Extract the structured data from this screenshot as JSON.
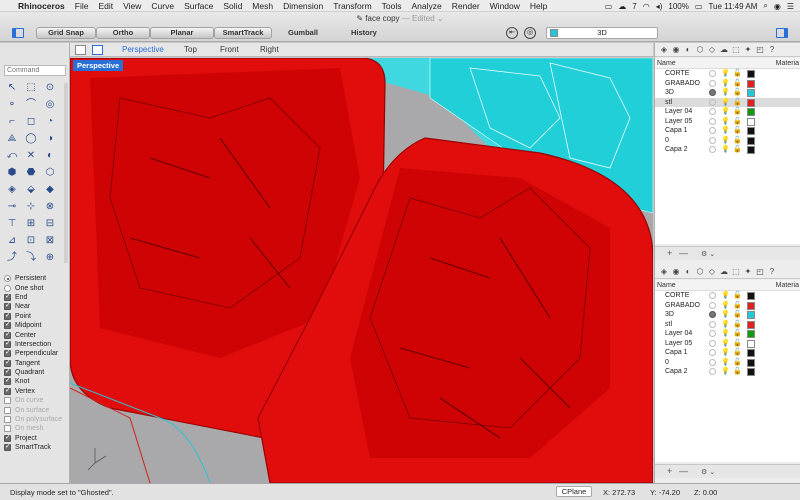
{
  "menubar": {
    "apple": "",
    "items": [
      "Rhinoceros",
      "File",
      "Edit",
      "View",
      "Curve",
      "Surface",
      "Solid",
      "Mesh",
      "Dimension",
      "Transform",
      "Tools",
      "Analyze",
      "Render",
      "Window",
      "Help"
    ],
    "status": {
      "wifi_count": "7",
      "battery": "100%",
      "clock": "Tue 11:49 AM"
    }
  },
  "window": {
    "title": "face copy",
    "edited": "— Edited ⌄"
  },
  "toolbar": {
    "grid_snap": "Grid Snap",
    "ortho": "Ortho",
    "planar": "Planar",
    "smarttrack": "SmartTrack",
    "gumball": "Gumball",
    "history": "History",
    "display_mode": "3D",
    "display_mode_color": "#22c8d8"
  },
  "viewtabs": {
    "perspective": "Perspective",
    "top": "Top",
    "front": "Front",
    "right": "Right"
  },
  "viewport": {
    "label": "Perspective",
    "background": "#a9a9ab",
    "mesh_color": "#e00000",
    "cyan_color": "#00d8e0"
  },
  "command": {
    "placeholder": "Command"
  },
  "tools": [
    "↖",
    "⬚",
    "⊙",
    "⚬",
    "⌒",
    "◎",
    "⌐",
    "◻",
    "◔",
    "⟁",
    "◯",
    "◑",
    "⤺",
    "✕",
    "◐",
    "⬢",
    "⬣",
    "⬡",
    "◈",
    "⬙",
    "◆",
    "⊸",
    "⊹",
    "⊗",
    "⊤",
    "⊞",
    "⊟",
    "⊿",
    "⊡",
    "⊠",
    "⤴",
    "⤵",
    "⊕"
  ],
  "osnaps": [
    {
      "label": "Persistent",
      "type": "radio",
      "checked": true
    },
    {
      "label": "One shot",
      "type": "radio",
      "checked": false
    },
    {
      "label": "End",
      "type": "check",
      "checked": true
    },
    {
      "label": "Near",
      "type": "check",
      "checked": true
    },
    {
      "label": "Point",
      "type": "check",
      "checked": true
    },
    {
      "label": "Midpoint",
      "type": "check",
      "checked": true
    },
    {
      "label": "Center",
      "type": "check",
      "checked": true
    },
    {
      "label": "Intersection",
      "type": "check",
      "checked": true
    },
    {
      "label": "Perpendicular",
      "type": "check",
      "checked": true
    },
    {
      "label": "Tangent",
      "type": "check",
      "checked": true
    },
    {
      "label": "Quadrant",
      "type": "check",
      "checked": true
    },
    {
      "label": "Knot",
      "type": "check",
      "checked": true
    },
    {
      "label": "Vertex",
      "type": "check",
      "checked": true
    },
    {
      "label": "On curve",
      "type": "check",
      "checked": false,
      "disabled": true
    },
    {
      "label": "On surface",
      "type": "check",
      "checked": false,
      "disabled": true
    },
    {
      "label": "On polysurface",
      "type": "check",
      "checked": false,
      "disabled": true
    },
    {
      "label": "On mesh",
      "type": "check",
      "checked": false,
      "disabled": true
    },
    {
      "label": "Project",
      "type": "check",
      "checked": true
    },
    {
      "label": "SmartTrack",
      "type": "check",
      "checked": true
    }
  ],
  "layers_panel": {
    "name_header": "Name",
    "material_header": "Materia",
    "layers_top": [
      {
        "name": "CORTE",
        "color": "#111111",
        "current": false
      },
      {
        "name": "GRABADO",
        "color": "#e02020",
        "current": false
      },
      {
        "name": "3D",
        "color": "#22c8d8",
        "current": true
      },
      {
        "name": "stl",
        "color": "#e02020",
        "current": false,
        "selected": true
      },
      {
        "name": "Layer 04",
        "color": "#119911",
        "current": false
      },
      {
        "name": "Layer 05",
        "color": "#ffffff",
        "current": false
      },
      {
        "name": "Capa 1",
        "color": "#111111",
        "current": false
      },
      {
        "name": "0",
        "color": "#111111",
        "current": false
      },
      {
        "name": "Capa 2",
        "color": "#111111",
        "current": false
      }
    ],
    "layers_bottom": [
      {
        "name": "CORTE",
        "color": "#111111",
        "current": false
      },
      {
        "name": "GRABADO",
        "color": "#e02020",
        "current": false
      },
      {
        "name": "3D",
        "color": "#22c8d8",
        "current": true
      },
      {
        "name": "stl",
        "color": "#e02020",
        "current": false
      },
      {
        "name": "Layer 04",
        "color": "#119911",
        "current": false
      },
      {
        "name": "Layer 05",
        "color": "#ffffff",
        "current": false
      },
      {
        "name": "Capa 1",
        "color": "#111111",
        "current": false
      },
      {
        "name": "0",
        "color": "#111111",
        "current": false
      },
      {
        "name": "Capa 2",
        "color": "#111111",
        "current": false
      }
    ],
    "add": "+",
    "remove": "—",
    "gear": "⚙ ⌄"
  },
  "statusbar": {
    "message": "Display mode set to \"Ghosted\".",
    "cplane": "CPlane",
    "x": "X: 272.73",
    "y": "Y: -74.20",
    "z": "Z: 0.00"
  }
}
